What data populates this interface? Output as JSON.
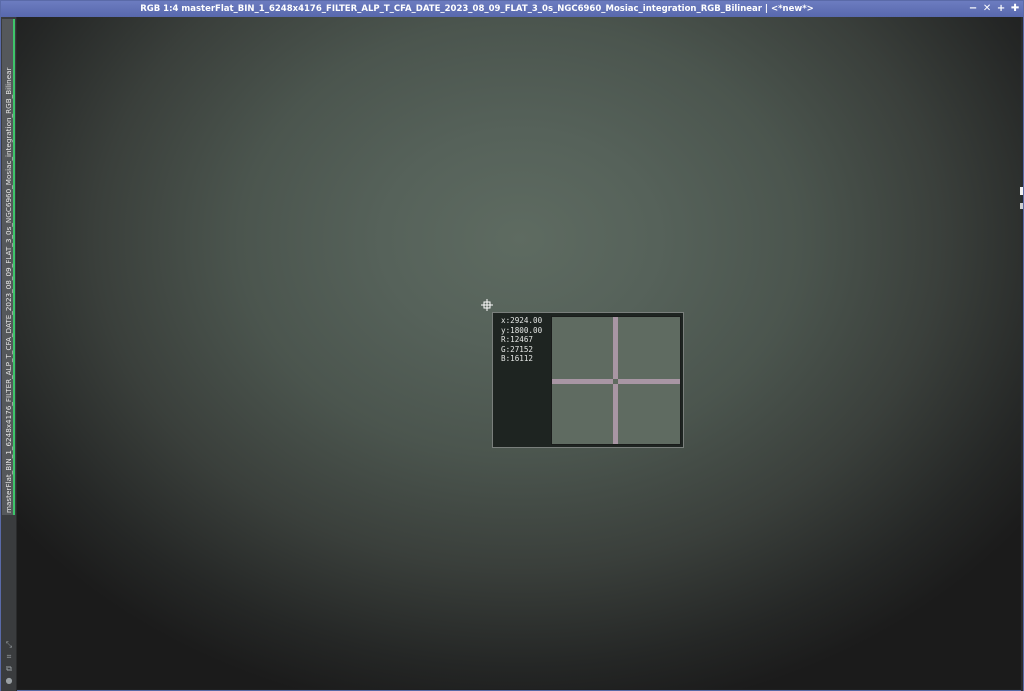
{
  "window": {
    "title": "RGB 1:4 masterFlat_BIN_1_6248x4176_FILTER_ALP_T_CFA_DATE_2023_08_09_FLAT_3_0s_NGC6960_Mosiac_integration_RGB_Bilinear | <*new*>",
    "controls": {
      "minimize": "−",
      "shade": "✕",
      "maximize": "+",
      "close": "✚"
    }
  },
  "sidebar": {
    "tab_label": "masterFlat_BIN_1_6248x4176_FILTER_ALP_T_CFA_DATE_2023_08_09_FLAT_3_0s_NGC6960_Mosiac_integration_RGB_Bilinear",
    "tools": {
      "collapse": "⤡",
      "fit": "⌗",
      "copy": "⧉",
      "status": "●"
    }
  },
  "readout": {
    "x": "x:2924.00",
    "y": "y:1800.00",
    "r": "R:12467",
    "g": "G:27152",
    "b": "B:16112"
  },
  "colors": {
    "titlebar": "#6c7cc0",
    "tab_accent": "#3ec46a",
    "crosshair": "#a896a4"
  }
}
